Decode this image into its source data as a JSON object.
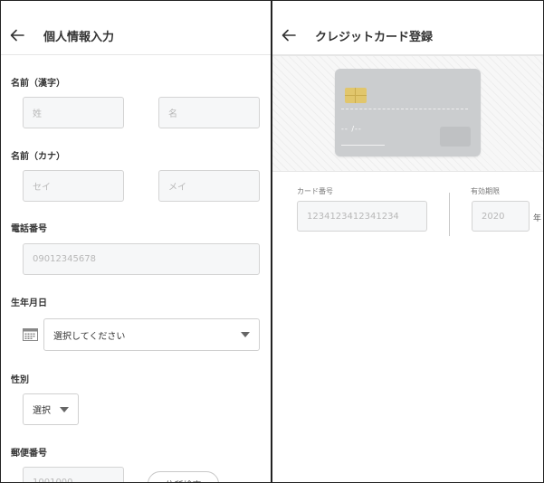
{
  "left": {
    "header": {
      "title": "個人情報入力"
    },
    "name_kanji": {
      "label": "名前（漢字）",
      "last_placeholder": "姓",
      "first_placeholder": "名"
    },
    "name_kana": {
      "label": "名前（カナ）",
      "last_placeholder": "セイ",
      "first_placeholder": "メイ"
    },
    "phone": {
      "label": "電話番号",
      "placeholder": "09012345678"
    },
    "birthday": {
      "label": "生年月日",
      "select_value": "選択してください"
    },
    "gender": {
      "label": "性別",
      "select_value": "選択"
    },
    "postal": {
      "label": "郵便番号",
      "placeholder": "1001000",
      "search_button": "住所検索"
    }
  },
  "right": {
    "header": {
      "title": "クレジットカード登録"
    },
    "card_preview": {
      "expiry_mask": "-- /--"
    },
    "card_number": {
      "label": "カード番号",
      "placeholder": "1234123412341234"
    },
    "expiry": {
      "label": "有効期限",
      "year_placeholder": "2020",
      "year_unit": "年"
    }
  },
  "icons": {
    "back": "arrow-left-icon",
    "calendar": "calendar-icon",
    "dropdown": "caret-down-icon"
  }
}
